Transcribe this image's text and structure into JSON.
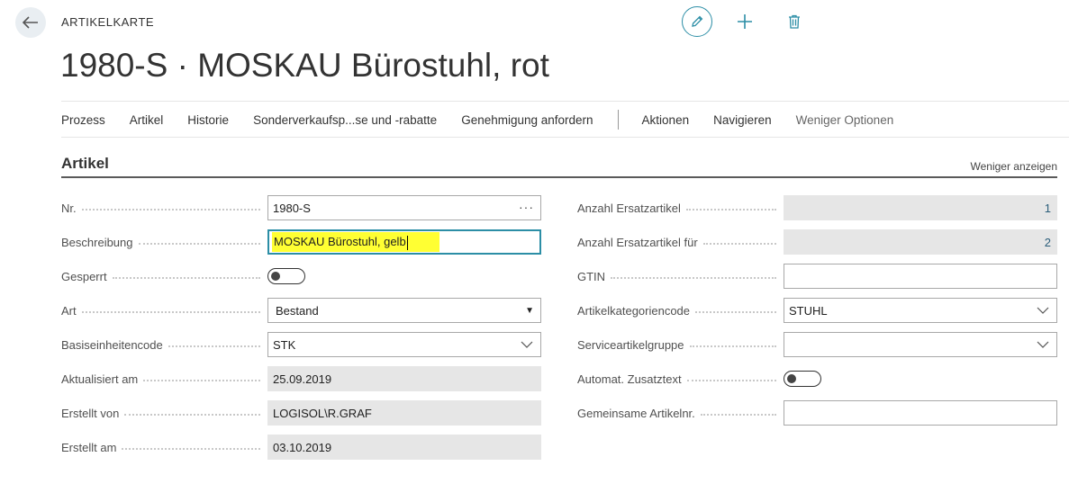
{
  "header": {
    "caption": "ARTIKELKARTE",
    "title": "1980-S · MOSKAU Bürostuhl, rot"
  },
  "actions": {
    "items": [
      "Prozess",
      "Artikel",
      "Historie",
      "Sonderverkaufsp...se und -rabatte",
      "Genehmigung anfordern"
    ],
    "secondary": [
      "Aktionen",
      "Navigieren"
    ],
    "fewer": "Weniger Optionen"
  },
  "section": {
    "title": "Artikel",
    "show_less": "Weniger anzeigen"
  },
  "left_fields": {
    "nr": {
      "label": "Nr.",
      "value": "1980-S"
    },
    "beschreibung": {
      "label": "Beschreibung",
      "value": "MOSKAU Bürostuhl, gelb"
    },
    "gesperrt": {
      "label": "Gesperrt"
    },
    "art": {
      "label": "Art",
      "value": "Bestand"
    },
    "basiseinheit": {
      "label": "Basiseinheitencode",
      "value": "STK"
    },
    "aktualisiert": {
      "label": "Aktualisiert am",
      "value": "25.09.2019"
    },
    "erstellt_von": {
      "label": "Erstellt von",
      "value": "LOGISOL\\R.GRAF"
    },
    "erstellt_am": {
      "label": "Erstellt am",
      "value": "03.10.2019"
    }
  },
  "right_fields": {
    "ersatz": {
      "label": "Anzahl Ersatzartikel",
      "value": "1"
    },
    "ersatz_fuer": {
      "label": "Anzahl Ersatzartikel für",
      "value": "2"
    },
    "gtin": {
      "label": "GTIN",
      "value": ""
    },
    "kategorie": {
      "label": "Artikelkategoriencode",
      "value": "STUHL"
    },
    "service": {
      "label": "Serviceartikelgruppe",
      "value": ""
    },
    "zusatztext": {
      "label": "Automat. Zusatztext"
    },
    "gemeinsame": {
      "label": "Gemeinsame Artikelnr.",
      "value": ""
    }
  },
  "colors": {
    "accent": "#2c8ea6",
    "highlight": "#ffff33",
    "readonly_bg": "#e6e6e6"
  },
  "icons": [
    "back-arrow-icon",
    "pencil-icon",
    "plus-icon",
    "trash-icon",
    "ellipsis-icon",
    "chevron-down-icon",
    "dropdown-triangle-icon"
  ]
}
